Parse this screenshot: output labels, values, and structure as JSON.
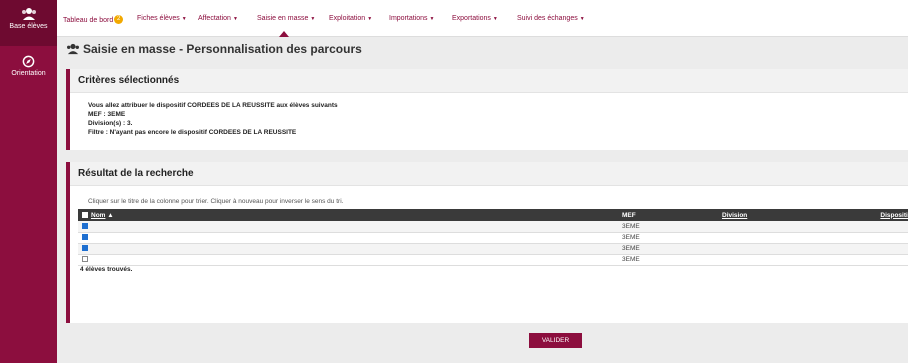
{
  "sidebar": {
    "items": [
      {
        "label": "Base élèves",
        "icon": "users-icon"
      },
      {
        "label": "Orientation",
        "icon": "compass-icon"
      }
    ]
  },
  "nav": {
    "tableau": "Tableau de bord",
    "tableau_badge": "2",
    "fiches": "Fiches élèves",
    "affectation": "Affectation",
    "saisie": "Saisie en masse",
    "exploitation": "Exploitation",
    "importations": "Importations",
    "exportations": "Exportations",
    "suivi": "Suivi des échanges"
  },
  "page": {
    "title": "Saisie en masse - Personnalisation des parcours"
  },
  "criteria": {
    "heading": "Critères sélectionnés",
    "line1": "Vous allez attribuer le dispositif CORDEES DE LA REUSSITE aux élèves suivants",
    "line2": "MEF : 3EME",
    "line3": "Division(s) : 3.",
    "line4": "Filtre : N'ayant pas encore le dispositif CORDEES DE LA REUSSITE"
  },
  "results": {
    "heading": "Résultat de la recherche",
    "hint": "Cliquer sur le titre de la colonne pour trier. Cliquer à nouveau pour inverser le sens du tri.",
    "columns": {
      "nom": "Nom",
      "mef": "MEF",
      "division": "Division",
      "dispositif": "Dispositif"
    },
    "rows": [
      {
        "checked": true,
        "nom": "",
        "mef": "3EME",
        "division": "",
        "dispositif": ""
      },
      {
        "checked": true,
        "nom": "",
        "mef": "3EME",
        "division": "",
        "dispositif": ""
      },
      {
        "checked": true,
        "nom": "",
        "mef": "3EME",
        "division": "",
        "dispositif": ""
      },
      {
        "checked": false,
        "nom": "",
        "mef": "3EME",
        "division": "",
        "dispositif": ""
      }
    ],
    "count": "4 élèves trouvés."
  },
  "actions": {
    "validate": "VALIDER"
  },
  "colors": {
    "brand": "#8c0e3e",
    "header_dark": "#3a3a3a",
    "checkbox": "#1e6fd0",
    "badge": "#f2a900"
  }
}
